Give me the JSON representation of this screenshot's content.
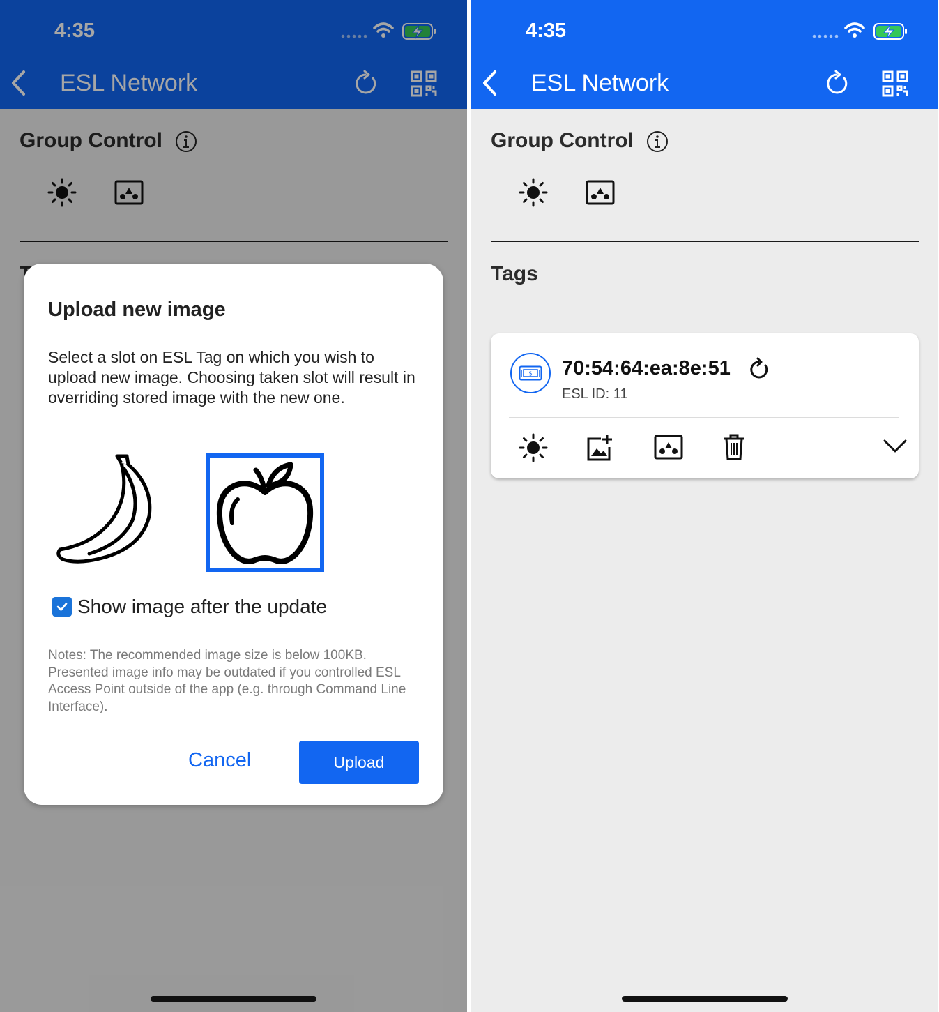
{
  "status_bar": {
    "time": "4:35"
  },
  "nav": {
    "title": "ESL Network"
  },
  "group_control": {
    "title": "Group Control"
  },
  "tags": {
    "title": "Tags",
    "items": [
      {
        "mac": "70:54:64:ea:8e:51",
        "esl_id": "ESL ID: 11"
      }
    ]
  },
  "dialog": {
    "title": "Upload new image",
    "message": "Select a slot on ESL Tag on which you wish to upload new image. Choosing taken slot will result in overriding stored image with the new one.",
    "slots": [
      {
        "icon": "banana-icon",
        "selected": false
      },
      {
        "icon": "apple-icon",
        "selected": true
      }
    ],
    "checkbox_label": "Show image after the update",
    "checkbox_checked": true,
    "notes": "Notes: The recommended image size is below 100KB. Presented image info may be outdated if you controlled ESL Access Point outside of the app (e.g. through Command Line Interface).",
    "cancel_label": "Cancel",
    "upload_label": "Upload"
  },
  "colors": {
    "nav_blue": "#1266f1",
    "background": "#ececec",
    "dim_overlay": "rgba(0,0,0,0.35)"
  }
}
